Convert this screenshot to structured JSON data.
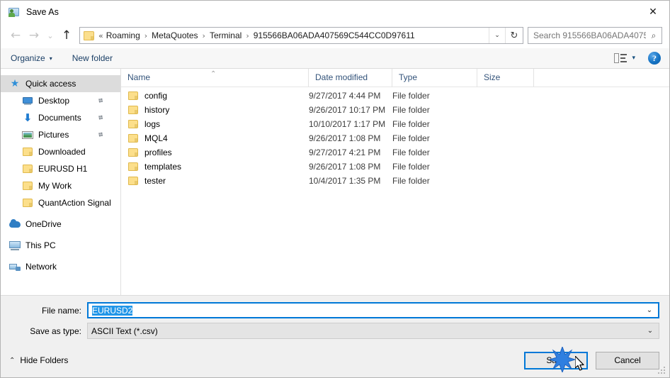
{
  "window": {
    "title": "Save As",
    "title_icon": "save-as-icon",
    "close_label": "✕"
  },
  "nav": {
    "back_icon": "←",
    "forward_icon": "→",
    "recent_icon": "⌄",
    "up_icon": "↑",
    "refresh_icon": "↻",
    "dropdown_icon": "⌄"
  },
  "address": {
    "lead": "«",
    "separator": "›",
    "crumbs": [
      "Roaming",
      "MetaQuotes",
      "Terminal",
      "915566BA06ADA407569C544CC0D97611"
    ]
  },
  "search": {
    "placeholder": "Search 915566BA06ADA40756...",
    "icon": "⌕"
  },
  "toolbar": {
    "organize_label": "Organize",
    "organize_caret": "▾",
    "new_folder_label": "New folder",
    "view_caret": "▾",
    "help_label": "?"
  },
  "sidebar": {
    "items": [
      {
        "label": "Quick access",
        "icon": "star-icon",
        "level": "root",
        "selected": true,
        "pinned": false
      },
      {
        "label": "Desktop",
        "icon": "desktop-icon",
        "level": "indent",
        "selected": false,
        "pinned": true
      },
      {
        "label": "Documents",
        "icon": "download-arrow-icon",
        "level": "indent",
        "selected": false,
        "pinned": true
      },
      {
        "label": "Pictures",
        "icon": "pictures-icon",
        "level": "indent",
        "selected": false,
        "pinned": true
      },
      {
        "label": "Downloaded",
        "icon": "folder-icon",
        "level": "indent",
        "selected": false,
        "pinned": false
      },
      {
        "label": "EURUSD H1",
        "icon": "folder-icon",
        "level": "indent",
        "selected": false,
        "pinned": false
      },
      {
        "label": "My Work",
        "icon": "folder-icon",
        "level": "indent",
        "selected": false,
        "pinned": false
      },
      {
        "label": "QuantAction Signal",
        "icon": "folder-icon",
        "level": "indent",
        "selected": false,
        "pinned": false
      },
      {
        "label": "OneDrive",
        "icon": "onedrive-icon",
        "level": "root",
        "selected": false,
        "pinned": false
      },
      {
        "label": "This PC",
        "icon": "this-pc-icon",
        "level": "root",
        "selected": false,
        "pinned": false
      },
      {
        "label": "Network",
        "icon": "network-icon",
        "level": "root",
        "selected": false,
        "pinned": false
      }
    ],
    "pin_icon": "📌"
  },
  "file_list": {
    "columns": [
      "Name",
      "Date modified",
      "Type",
      "Size"
    ],
    "sort_caret": "⌃",
    "rows": [
      {
        "name": "config",
        "date": "9/27/2017 4:44 PM",
        "type": "File folder",
        "size": ""
      },
      {
        "name": "history",
        "date": "9/26/2017 10:17 PM",
        "type": "File folder",
        "size": ""
      },
      {
        "name": "logs",
        "date": "10/10/2017 1:17 PM",
        "type": "File folder",
        "size": ""
      },
      {
        "name": "MQL4",
        "date": "9/26/2017 1:08 PM",
        "type": "File folder",
        "size": ""
      },
      {
        "name": "profiles",
        "date": "9/27/2017 4:21 PM",
        "type": "File folder",
        "size": ""
      },
      {
        "name": "templates",
        "date": "9/26/2017 1:08 PM",
        "type": "File folder",
        "size": ""
      },
      {
        "name": "tester",
        "date": "10/4/2017 1:35 PM",
        "type": "File folder",
        "size": ""
      }
    ]
  },
  "form": {
    "file_name_label": "File name:",
    "file_name_value": "EURUSD2",
    "save_as_type_label": "Save as type:",
    "save_as_type_value": "ASCII Text (*.csv)",
    "caret": "⌄"
  },
  "footer": {
    "hide_folders_label": "Hide Folders",
    "hide_folders_caret": "⌃",
    "save_label": "Save",
    "cancel_label": "Cancel"
  },
  "colors": {
    "accent": "#0078d7",
    "selection_blue": "#2196e8",
    "folder_yellow": "#fcdf8b",
    "header_text": "#33537a",
    "chrome_gray": "#f0f0f0"
  }
}
